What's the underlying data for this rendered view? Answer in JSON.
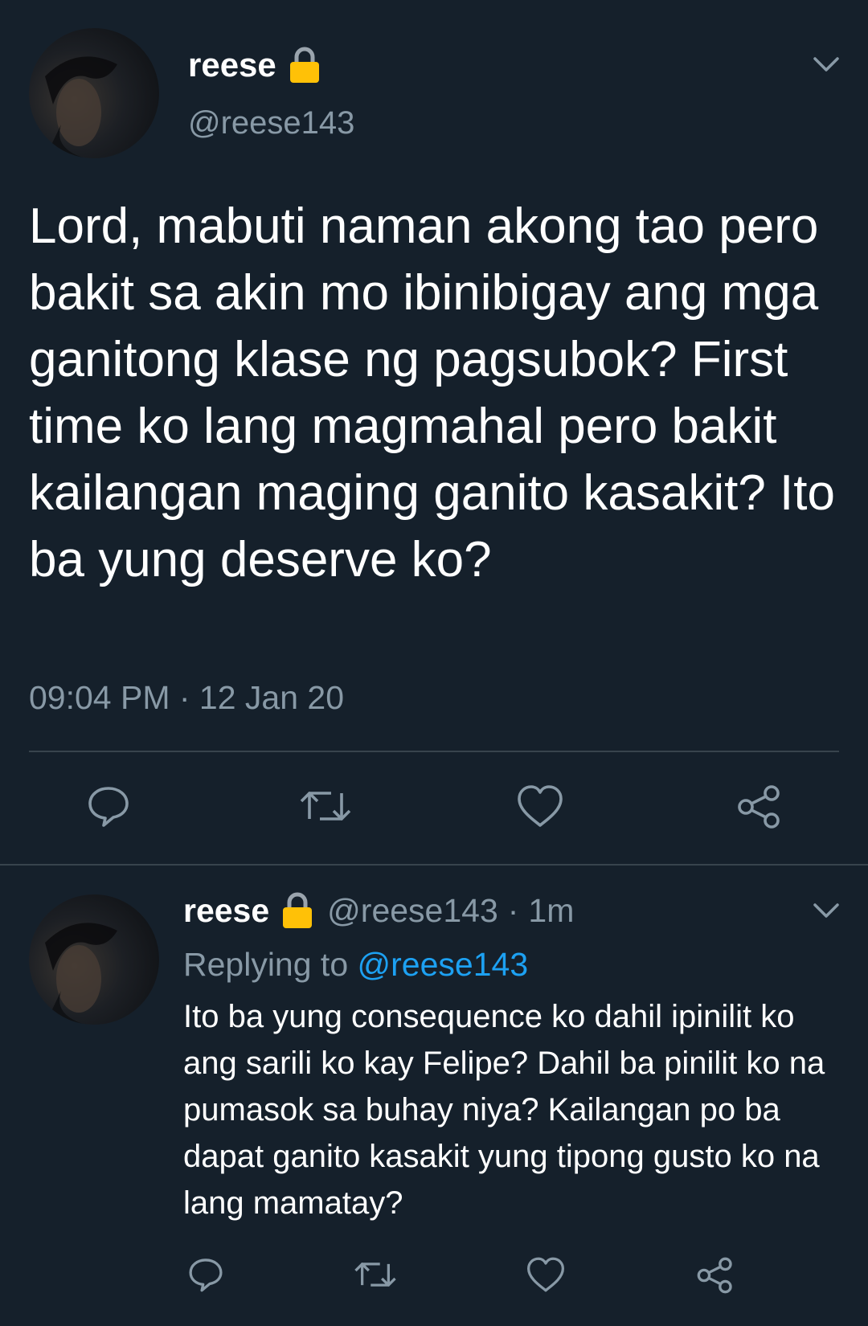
{
  "main_tweet": {
    "display_name": "reese",
    "handle": "@reese143",
    "text": "Lord, mabuti naman akong tao pero bakit sa akin mo ibinibigay ang mga ganitong klase ng pagsubok? First time ko lang magmahal pero bakit kailangan maging ganito kasakit? Ito ba yung deserve ko?",
    "timestamp": "09:04 PM · 12 Jan 20",
    "locked": true,
    "avatar": "profile-photo",
    "actions": [
      "reply-icon",
      "retweet-icon",
      "like-icon",
      "share-icon"
    ]
  },
  "reply_tweet": {
    "display_name": "reese",
    "handle": "@reese143",
    "separator": "·",
    "time_ago": "1m",
    "replying_prefix": "Replying to",
    "replying_to": "@reese143",
    "text": "Ito ba yung consequence ko dahil ipinilit ko ang sarili ko kay Felipe? Dahil ba pinilit ko na pumasok sa buhay niya? Kailangan po ba dapat ganito kasakit yung tipong gusto ko na lang mamatay?",
    "locked": true,
    "avatar": "profile-photo",
    "actions": [
      "reply-icon",
      "retweet-icon",
      "like-icon",
      "share-icon"
    ]
  },
  "colors": {
    "background": "#15202b",
    "primary_text": "#ffffff",
    "secondary_text": "#8899a6",
    "mention": "#1da1f2",
    "divider": "#38444d",
    "lock": "#ffc107"
  }
}
